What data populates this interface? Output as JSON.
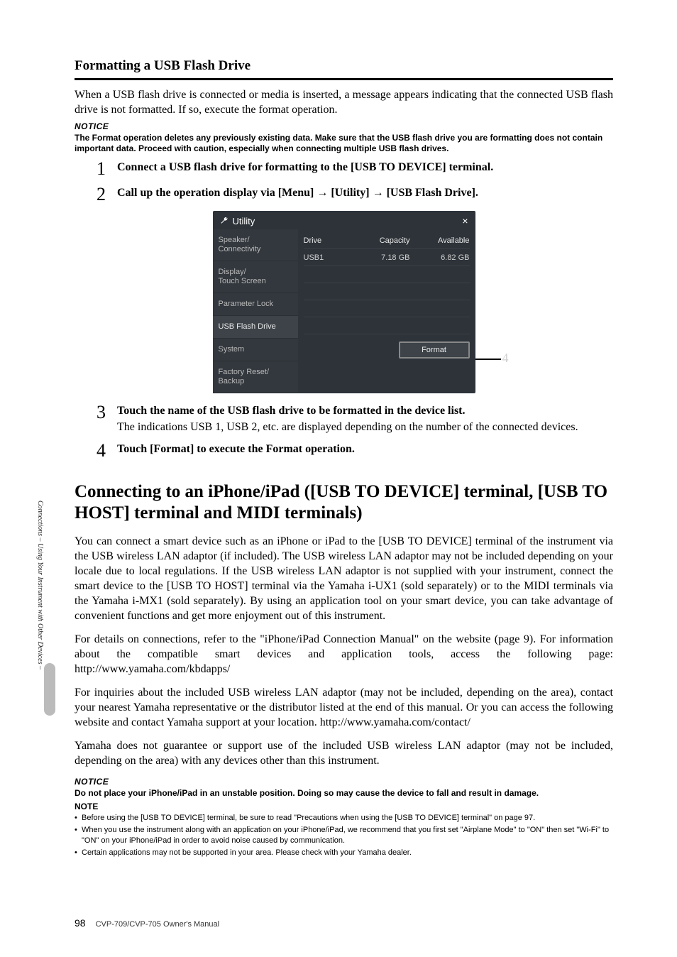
{
  "side_label": "Connections – Using Your Instrument with Other Devices –",
  "section1": {
    "heading": "Formatting a USB Flash Drive",
    "intro": "When a USB flash drive is connected or media is inserted, a message appears indicating that the connected USB flash drive is not formatted. If so, execute the format operation.",
    "notice_label": "NOTICE",
    "notice_text": "The Format operation deletes any previously existing data. Make sure that the USB flash drive you are formatting does not contain important data. Proceed with caution, especially when connecting multiple USB flash drives."
  },
  "steps": [
    {
      "num": "1",
      "title": "Connect a USB flash drive for formatting to the [USB TO DEVICE] terminal."
    },
    {
      "num": "2",
      "title": "Call up the operation display via [Menu] → [Utility] → [USB Flash Drive]."
    },
    {
      "num": "3",
      "title": "Touch the name of the USB flash drive to be formatted in the device list.",
      "desc": "The indications USB 1, USB 2, etc. are displayed depending on the number of the connected devices."
    },
    {
      "num": "4",
      "title": "Touch [Format] to execute the Format operation."
    }
  ],
  "screenshot": {
    "window_title": "Utility",
    "close": "×",
    "sidebar": [
      "Speaker/\nConnectivity",
      "Display/\nTouch Screen",
      "Parameter Lock",
      "USB Flash Drive",
      "System",
      "Factory Reset/\nBackup"
    ],
    "active_index": 3,
    "headers": {
      "drive": "Drive",
      "capacity": "Capacity",
      "available": "Available"
    },
    "row": {
      "drive": "USB1",
      "capacity": "7.18 GB",
      "available": "6.82 GB"
    },
    "format_label": "Format",
    "callout": "4"
  },
  "section2": {
    "heading": "Connecting to an iPhone/iPad ([USB TO DEVICE] terminal, [USB TO HOST] terminal and MIDI terminals)",
    "para1": "You can connect a smart device such as an iPhone or iPad to the [USB TO DEVICE] terminal of the instrument via the USB wireless LAN adaptor (if included). The USB wireless LAN adaptor may not be included depending on your locale due to local regulations. If the USB wireless LAN adaptor is not supplied with your instrument, connect the smart device to the [USB TO HOST] terminal via the Yamaha i-UX1 (sold separately) or to the MIDI terminals via the Yamaha i-MX1 (sold separately). By using an application tool on your smart device, you can take advantage of convenient functions and get more enjoyment out of this instrument.",
    "para2": "For details on connections, refer to the \"iPhone/iPad Connection Manual\" on the website (page 9). For information about the compatible smart devices and application tools, access the following page: http://www.yamaha.com/kbdapps/",
    "para3": "For inquiries about the included USB wireless LAN adaptor (may not be included, depending on the area), contact your nearest Yamaha representative or the distributor listed at the end of this manual. Or you can access the following website and contact Yamaha support at your location. http://www.yamaha.com/contact/",
    "para4": "Yamaha does not guarantee or support use of the included USB wireless LAN adaptor (may not be included, depending on the area) with any devices other than this instrument.",
    "notice_label": "NOTICE",
    "notice_text": "Do not place your iPhone/iPad in an unstable position. Doing so may cause the device to fall and result in damage.",
    "note_label": "NOTE",
    "bullets": [
      "Before using the [USB TO DEVICE] terminal, be sure to read \"Precautions when using the [USB TO DEVICE] terminal\" on page 97.",
      "When you use the instrument along with an application on your iPhone/iPad, we recommend that you first set \"Airplane Mode\" to \"ON\" then set \"Wi-Fi\" to \"ON\" on your iPhone/iPad in order to avoid noise caused by communication.",
      "Certain applications may not be supported in your area. Please check with your Yamaha dealer."
    ]
  },
  "footer": {
    "page": "98",
    "manual": "CVP-709/CVP-705 Owner's Manual"
  }
}
